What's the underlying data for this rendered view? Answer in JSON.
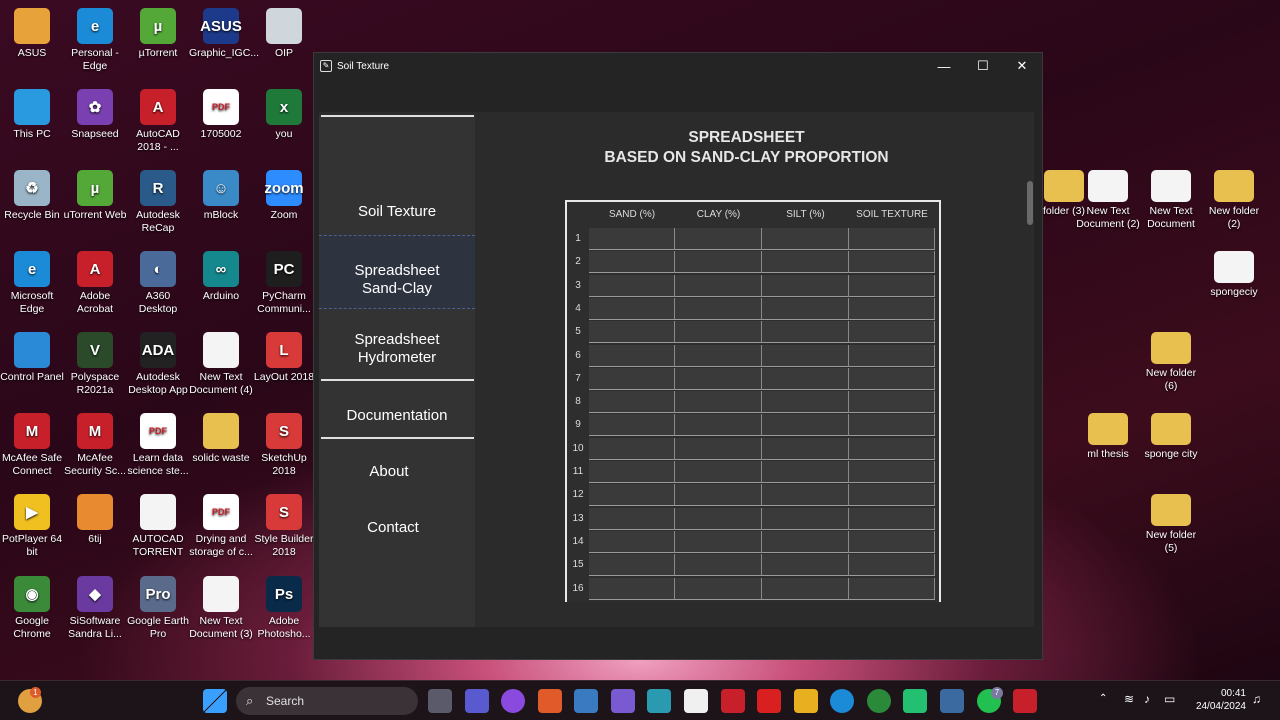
{
  "desktop_icons": [
    {
      "label": "ASUS",
      "color": "#e8a23a",
      "glyph": ""
    },
    {
      "label": "Personal - Edge",
      "color": "#1b8bd8",
      "glyph": "e"
    },
    {
      "label": "µTorrent",
      "color": "#54a838",
      "glyph": "µ"
    },
    {
      "label": "Graphic_IGC...",
      "color": "#1d3a8a",
      "glyph": "ASUS"
    },
    {
      "label": "OIP",
      "color": "#cfd6dc",
      "glyph": ""
    },
    {
      "label": "This PC",
      "color": "#2a9ae0",
      "glyph": ""
    },
    {
      "label": "Snapseed",
      "color": "#7a3fb0",
      "glyph": "✿"
    },
    {
      "label": "AutoCAD 2018 - ...",
      "color": "#c8202a",
      "glyph": "A"
    },
    {
      "label": "1705002",
      "color": "#ffffff",
      "glyph": "PDF"
    },
    {
      "label": "you",
      "color": "#1f7a3a",
      "glyph": "x"
    },
    {
      "label": "Recycle Bin",
      "color": "#9ab4c8",
      "glyph": "♻"
    },
    {
      "label": "uTorrent Web",
      "color": "#54a838",
      "glyph": "µ"
    },
    {
      "label": "Autodesk ReCap",
      "color": "#2a5a8a",
      "glyph": "R"
    },
    {
      "label": "mBlock",
      "color": "#3a8ac8",
      "glyph": "☺"
    },
    {
      "label": "Zoom",
      "color": "#2d8cff",
      "glyph": "zoom"
    },
    {
      "label": "Microsoft Edge",
      "color": "#1b8bd8",
      "glyph": "e"
    },
    {
      "label": "Adobe Acrobat",
      "color": "#c8202a",
      "glyph": "A"
    },
    {
      "label": "A360 Desktop",
      "color": "#4a6a9a",
      "glyph": "◐"
    },
    {
      "label": "Arduino",
      "color": "#14888c",
      "glyph": "∞"
    },
    {
      "label": "PyCharm Communi...",
      "color": "#1e1e1e",
      "glyph": "PC"
    },
    {
      "label": "Control Panel",
      "color": "#2a8ad8",
      "glyph": ""
    },
    {
      "label": "Polyspace R2021a",
      "color": "#2a4a2a",
      "glyph": "V"
    },
    {
      "label": "Autodesk Desktop App",
      "color": "#222222",
      "glyph": "ADA"
    },
    {
      "label": "New Text Document (4)",
      "color": "#f4f4f4",
      "glyph": ""
    },
    {
      "label": "LayOut 2018",
      "color": "#d83a3a",
      "glyph": "L"
    },
    {
      "label": "McAfee Safe Connect",
      "color": "#c8202a",
      "glyph": "M"
    },
    {
      "label": "McAfee Security Sc...",
      "color": "#c8202a",
      "glyph": "M"
    },
    {
      "label": "Learn data science ste...",
      "color": "#ffffff",
      "glyph": "PDF"
    },
    {
      "label": "solidc waste",
      "color": "#e8c050",
      "glyph": ""
    },
    {
      "label": "SketchUp 2018",
      "color": "#d83a3a",
      "glyph": "S"
    },
    {
      "label": "PotPlayer 64 bit",
      "color": "#f0c020",
      "glyph": "▶"
    },
    {
      "label": "6tij",
      "color": "#e88a30",
      "glyph": ""
    },
    {
      "label": "AUTOCAD TORRENT",
      "color": "#f4f4f4",
      "glyph": ""
    },
    {
      "label": "Drying and storage of c...",
      "color": "#ffffff",
      "glyph": "PDF"
    },
    {
      "label": "Style Builder 2018",
      "color": "#d83a3a",
      "glyph": "S"
    },
    {
      "label": "Google Chrome",
      "color": "#3a8a3a",
      "glyph": "◉"
    },
    {
      "label": "SiSoftware Sandra Li...",
      "color": "#6a3aa0",
      "glyph": "◆"
    },
    {
      "label": "Google Earth Pro",
      "color": "#5a6a8a",
      "glyph": "Pro"
    },
    {
      "label": "New Text Document (3)",
      "color": "#f4f4f4",
      "glyph": ""
    },
    {
      "label": "Adobe Photosho...",
      "color": "#0a2a4a",
      "glyph": "Ps"
    }
  ],
  "right_icons": [
    {
      "label": "folder (3)",
      "color": "#e8c050"
    },
    {
      "label": "New Text Document (2)",
      "color": "#f4f4f4"
    },
    {
      "label": "New Text Document",
      "color": "#f4f4f4"
    },
    {
      "label": "New folder (2)",
      "color": "#e8c050"
    },
    {
      "label": "spongeciy",
      "color": "#f4f4f4"
    },
    {
      "label": "New folder (6)",
      "color": "#e8c050"
    },
    {
      "label": "ml thesis",
      "color": "#e8c050"
    },
    {
      "label": "sponge city",
      "color": "#e8c050"
    },
    {
      "label": "New folder (5)",
      "color": "#e8c050"
    }
  ],
  "window": {
    "title": "Soil Texture",
    "controls": {
      "minimize": "—",
      "maximize": "☐",
      "close": "✕"
    }
  },
  "sidebar": {
    "items": [
      {
        "label": "Soil Texture"
      },
      {
        "label": "Spreadsheet\nSand-Clay",
        "active": true
      },
      {
        "label": "Spreadsheet\nHydrometer"
      },
      {
        "label": "Documentation"
      },
      {
        "label": "About"
      },
      {
        "label": "Contact"
      }
    ]
  },
  "main": {
    "title_line1": "SPREADSHEET",
    "title_line2": "BASED ON SAND-CLAY PROPORTION"
  },
  "sheet": {
    "columns": [
      "SAND (%)",
      "CLAY (%)",
      "SILT (%)",
      "SOIL TEXTURE"
    ],
    "rows": [
      "1",
      "2",
      "3",
      "4",
      "5",
      "6",
      "7",
      "8",
      "9",
      "10",
      "11",
      "12",
      "13",
      "14",
      "15",
      "16"
    ]
  },
  "taskbar": {
    "search_placeholder": "Search",
    "time": "00:41",
    "date": "24/04/2024",
    "notification_badge": "1",
    "whatsapp_badge": "7"
  }
}
